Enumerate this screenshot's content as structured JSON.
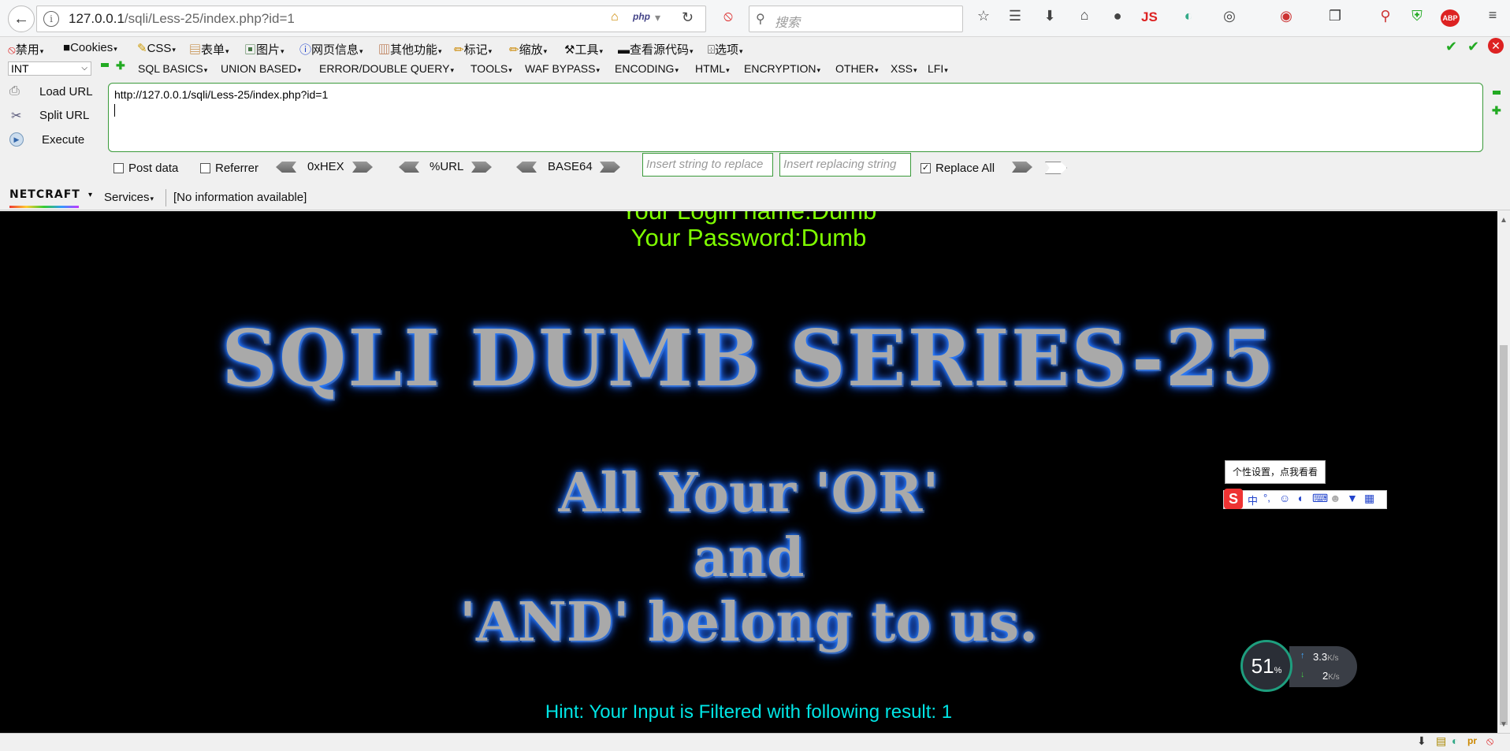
{
  "browser": {
    "url_host": "127.0.0.1",
    "url_path": "/sqli/Less-25/index.php?id=1",
    "search_placeholder": "搜索",
    "php_label": "php"
  },
  "menubar": {
    "items": [
      "禁用",
      "Cookies",
      "CSS",
      "表单",
      "图片",
      "网页信息",
      "其他功能",
      "标记",
      "缩放",
      "工具",
      "查看源代码",
      "选项"
    ]
  },
  "hackbar": {
    "type_select": "INT",
    "menus": [
      "SQL BASICS",
      "UNION BASED",
      "ERROR/DOUBLE QUERY",
      "TOOLS",
      "WAF BYPASS",
      "ENCODING",
      "HTML",
      "ENCRYPTION",
      "OTHER",
      "XSS",
      "LFI"
    ],
    "load_url": "Load URL",
    "split_url": "Split URL",
    "execute": "Execute",
    "textarea_value": "http://127.0.0.1/sqli/Less-25/index.php?id=1",
    "post_data": "Post data",
    "referrer": "Referrer",
    "hex": "0xHEX",
    "url_enc": "%URL",
    "base64": "BASE64",
    "insert_placeholder": "Insert string to replace",
    "replacing_placeholder": "Insert replacing string",
    "replace_all": "Replace All",
    "post_checked": false,
    "referrer_checked": false,
    "replace_all_checked": true
  },
  "netcraft": {
    "logo": "NETCRAFT",
    "services": "Services",
    "info": "[No information available]"
  },
  "page": {
    "login_line": "Your Login name:Dumb",
    "password_line": "Your Password:Dumb",
    "title": "SQLI DUMB SERIES-25",
    "banner_line1": "All Your 'OR'",
    "banner_line2": "and",
    "banner_line3": "'AND' belong to us.",
    "hint": "Hint: Your Input is Filtered with following result: 1"
  },
  "overlays": {
    "sogou_tip": "个性设置，点我看看",
    "sogou_zh": "中",
    "net_percent": "51",
    "net_percent_unit": "%",
    "net_up": "3.3",
    "net_down": "2",
    "net_unit": "K/s"
  },
  "colors": {
    "login_text": "#7fff00",
    "hint_text": "#00e5e5",
    "title_glow": "#2a7fff",
    "hackbar_border": "#3a9a3a"
  }
}
